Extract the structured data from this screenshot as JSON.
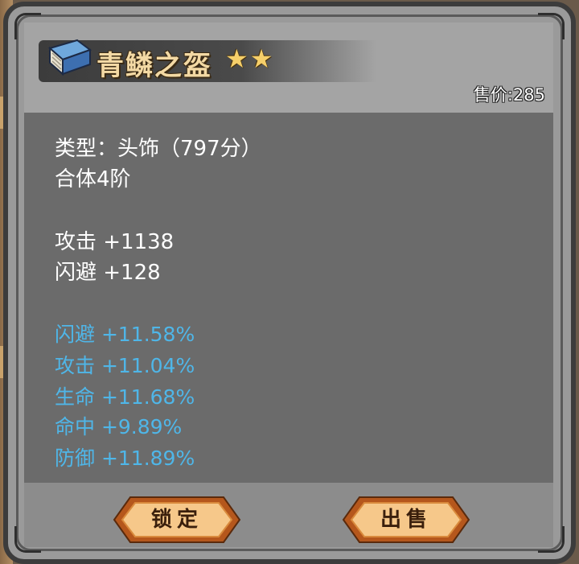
{
  "item": {
    "name": "青鳞之盔",
    "stars": "★★",
    "price": "售价:285",
    "icon": "book-icon"
  },
  "info": {
    "type": "类型：头饰（797分）",
    "tier": "合体4阶"
  },
  "base_stats": [
    "攻击 +1138",
    "闪避 +128"
  ],
  "bonus_stats": [
    "闪避 +11.58%",
    "攻击 +11.04%",
    "生命 +11.68%",
    "命中 +9.89%",
    "防御 +11.89%"
  ],
  "buttons": {
    "lock": "锁定",
    "sell": "出售"
  },
  "colors": {
    "bonus_text": "#4fb6e8",
    "title_text": "#f3d9a4",
    "button_fill": "#f6c88a",
    "button_border": "#b5571c"
  }
}
